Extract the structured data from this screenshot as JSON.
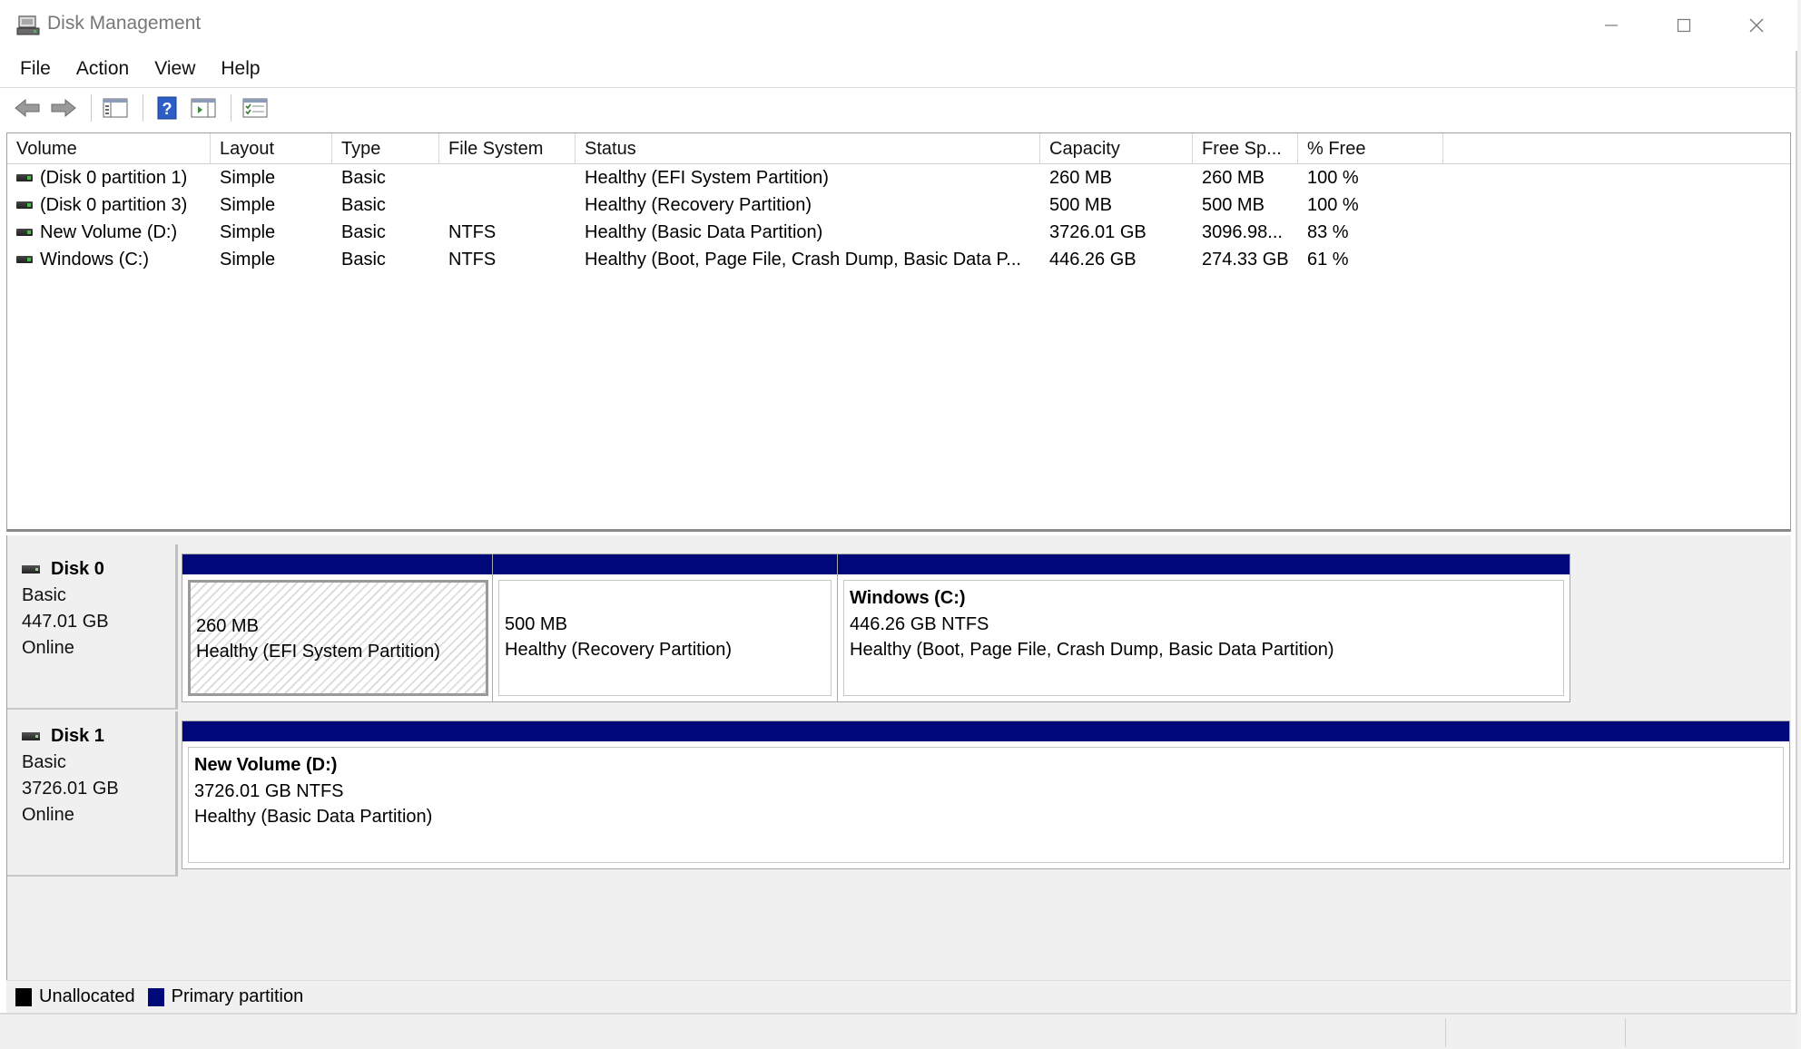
{
  "window": {
    "title": "Disk Management"
  },
  "menu": [
    "File",
    "Action",
    "View",
    "Help"
  ],
  "toolbar": {
    "icons": [
      "back-arrow-icon",
      "forward-arrow-icon",
      "console-tree-icon",
      "help-icon",
      "properties-view-icon",
      "checklist-icon"
    ]
  },
  "table": {
    "columns": [
      "Volume",
      "Layout",
      "Type",
      "File System",
      "Status",
      "Capacity",
      "Free Sp...",
      "% Free"
    ],
    "rows": [
      [
        "(Disk 0 partition 1)",
        "Simple",
        "Basic",
        "",
        "Healthy (EFI System Partition)",
        "260 MB",
        "260 MB",
        "100 %"
      ],
      [
        "(Disk 0 partition 3)",
        "Simple",
        "Basic",
        "",
        "Healthy (Recovery Partition)",
        "500 MB",
        "500 MB",
        "100 %"
      ],
      [
        "New Volume (D:)",
        "Simple",
        "Basic",
        "NTFS",
        "Healthy (Basic Data Partition)",
        "3726.01 GB",
        "3096.98...",
        "83 %"
      ],
      [
        "Windows (C:)",
        "Simple",
        "Basic",
        "NTFS",
        "Healthy (Boot, Page File, Crash Dump, Basic Data P...",
        "446.26 GB",
        "274.33 GB",
        "61 %"
      ]
    ]
  },
  "disks": [
    {
      "name": "Disk 0",
      "type": "Basic",
      "size": "447.01 GB",
      "state": "Online",
      "partitions": [
        {
          "title": "",
          "size": "260 MB",
          "status": "Healthy (EFI System Partition)"
        },
        {
          "title": "",
          "size": "500 MB",
          "status": "Healthy (Recovery Partition)"
        },
        {
          "title": "Windows  (C:)",
          "size": "446.26 GB NTFS",
          "status": "Healthy (Boot, Page File, Crash Dump, Basic Data Partition)"
        }
      ]
    },
    {
      "name": "Disk 1",
      "type": "Basic",
      "size": "3726.01 GB",
      "state": "Online",
      "partitions": [
        {
          "title": "New Volume  (D:)",
          "size": "3726.01 GB NTFS",
          "status": "Healthy (Basic Data Partition)"
        }
      ]
    }
  ],
  "legend": [
    {
      "label": "Unallocated",
      "color": "#000000"
    },
    {
      "label": "Primary partition",
      "color": "#00087a"
    }
  ],
  "colors": {
    "primary_partition": "#00087a",
    "unallocated": "#000000"
  }
}
